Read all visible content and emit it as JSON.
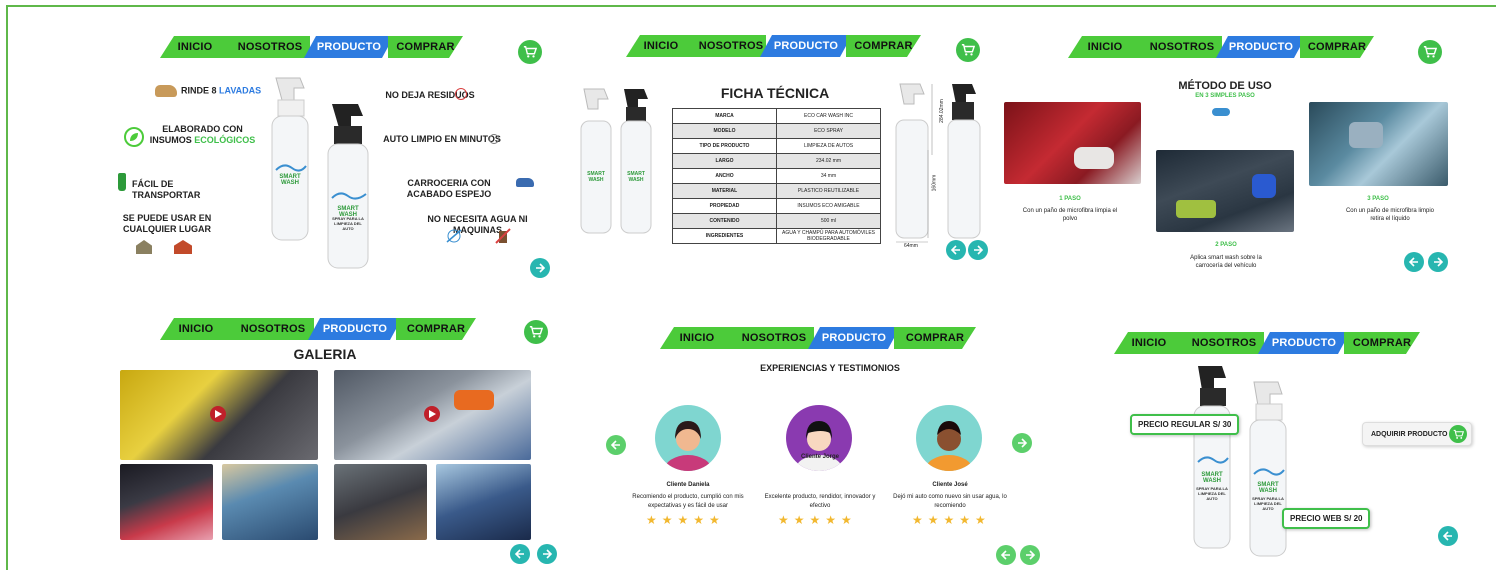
{
  "nav": {
    "inicio": "INICIO",
    "nosotros": "NOSOTROS",
    "producto": "PRODUCTO",
    "comprar": "COMPRAR"
  },
  "panel1": {
    "features_left": [
      {
        "text": "RINDE 8 ",
        "highlight": "LAVADAS",
        "icon": "car-wash-icon"
      },
      {
        "text": "ELABORADO CON INSUMOS ",
        "highlight": "ECOLÓGICOS",
        "icon": "leaf-icon"
      },
      {
        "text": "FÁCIL DE TRANSPORTAR",
        "icon": "spray-bottle-icon"
      },
      {
        "text": "SE PUEDE USAR EN CUALQUIER LUGAR",
        "icon": "house-icon"
      }
    ],
    "features_right": [
      {
        "text": "NO DEJA RESIDUOS",
        "icon": "no-residue-icon"
      },
      {
        "text": "AUTO LIMPIO EN MINUTOS",
        "icon": "clock-icon"
      },
      {
        "text": "CARROCERIA CON ACABADO ESPEJO",
        "icon": "car-icon"
      },
      {
        "text": "NO NECESITA AGUA NI MAQUINAS",
        "icon": "no-water-icon"
      }
    ]
  },
  "bottle": {
    "brand": "SMART WASH",
    "tagline": "SPRAY PARA LA LIMPIEZA DEL AUTO"
  },
  "panel2": {
    "title": "FICHA TÉCNICA",
    "rows": [
      {
        "k": "MARCA",
        "v": "ECO CAR WASH INC"
      },
      {
        "k": "MODELO",
        "v": "ECO SPRAY"
      },
      {
        "k": "TIPO DE PRODUCTO",
        "v": "LIMPIEZA DE AUTOS"
      },
      {
        "k": "LARGO",
        "v": "234.02 mm"
      },
      {
        "k": "ANCHO",
        "v": "34 mm"
      },
      {
        "k": "MATERIAL",
        "v": "PLASTICO REUTILIZABLE"
      },
      {
        "k": "PROPIEDAD",
        "v": "INSUMOS ECO AMIGABLE"
      },
      {
        "k": "CONTENIDO",
        "v": "500 ml"
      },
      {
        "k": "INGREDIENTES",
        "v": "AGUA Y CHAMPÚ PARA AUTOMÓVILES BIODEGRADABLE"
      }
    ],
    "dim_height": "284.02mm",
    "dim_body": "160mm",
    "dim_width": "64mm"
  },
  "panel3": {
    "title": "MÉTODO DE USO",
    "subtitle": "EN 3 SIMPLES PASO",
    "steps": [
      {
        "title": "1 PASO",
        "text": "Con un paño de microfibra limpia el polvo"
      },
      {
        "title": "2 PASO",
        "text": "Aplica smart wash sobre la carrocería del vehículo"
      },
      {
        "title": "3 PASO",
        "text": "Con un paño de microfibra limpio retira el líquido"
      }
    ]
  },
  "panel4": {
    "title": "GALERIA"
  },
  "panel5": {
    "title": "EXPERIENCIAS Y TESTIMONIOS",
    "testimonials": [
      {
        "name": "Cliente Daniela",
        "text": "Recomiendo el producto, cumplió con mis expectativas y es fácil de usar",
        "stars": "★★★★★"
      },
      {
        "name": "Cliente Jorge",
        "text": "Excelente producto, rendidor, innovador y efectivo",
        "stars": "★★★★★"
      },
      {
        "name": "Cliente José",
        "text": "Dejó mi auto como nuevo sin usar agua, lo recomiendo",
        "stars": "★★★★★"
      }
    ]
  },
  "panel6": {
    "price_regular": "PRECIO REGULAR S/ 30",
    "price_web": "PRECIO WEB S/ 20",
    "buy": "ADQUIRIR PRODUCTO"
  },
  "colors": {
    "green": "#4ccb3a",
    "blue": "#2d7be0",
    "teal": "#27b6b0"
  }
}
